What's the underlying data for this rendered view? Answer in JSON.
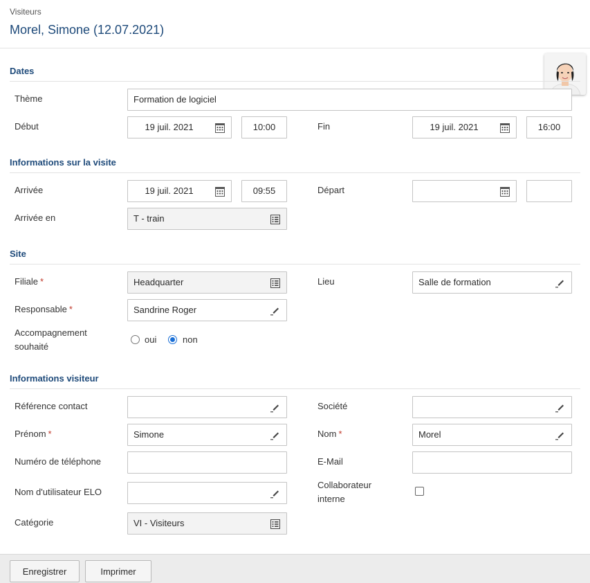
{
  "header": {
    "category": "Visiteurs",
    "title": "Morel, Simone (12.07.2021)"
  },
  "sections": {
    "dates": "Dates",
    "visit_info": "Informations sur la visite",
    "site": "Site",
    "visitor_info": "Informations visiteur"
  },
  "dates": {
    "theme_label": "Thème",
    "theme_value": "Formation de logiciel",
    "start_label": "Début",
    "start_date": "19 juil. 2021",
    "start_time": "10:00",
    "end_label": "Fin",
    "end_date": "19 juil. 2021",
    "end_time": "16:00"
  },
  "visit": {
    "arrival_label": "Arrivée",
    "arrival_date": "19 juil. 2021",
    "arrival_time": "09:55",
    "departure_label": "Départ",
    "departure_date": "",
    "departure_time": "",
    "arrival_by_label": "Arrivée en",
    "arrival_by_value": "T - train"
  },
  "site": {
    "branch_label": "Filiale",
    "branch_value": "Headquarter",
    "place_label": "Lieu",
    "place_value": "Salle de formation",
    "responsible_label": "Responsable",
    "responsible_value": "Sandrine Roger",
    "escort_label_line1": "Accompagnement",
    "escort_label_line2": "souhaité",
    "escort_yes": "oui",
    "escort_no": "non",
    "escort_selected": "non"
  },
  "visitor": {
    "contact_ref_label": "Référence contact",
    "contact_ref_value": "",
    "company_label": "Société",
    "company_value": "",
    "firstname_label": "Prénom",
    "firstname_value": "Simone",
    "lastname_label": "Nom",
    "lastname_value": "Morel",
    "phone_label": "Numéro de téléphone",
    "phone_value": "",
    "email_label": "E-Mail",
    "email_value": "",
    "elo_user_label": "Nom d'utilisateur ELO",
    "elo_user_value": "",
    "internal_label_line1": "Collaborateur",
    "internal_label_line2": "interne",
    "internal_checked": false,
    "category_label": "Catégorie",
    "category_value": "VI - Visiteurs"
  },
  "required_marker": "*",
  "footer": {
    "save_label": "Enregistrer",
    "print_label": "Imprimer"
  },
  "icons": {
    "calendar": "calendar-icon",
    "list": "list-icon",
    "edit": "pencil-icon",
    "photo": "visitor-photo"
  },
  "colors": {
    "section_title": "#1e4a7a",
    "required": "#c0392b",
    "radio_selected": "#1a6fd6",
    "footer_bg": "#ececec"
  }
}
